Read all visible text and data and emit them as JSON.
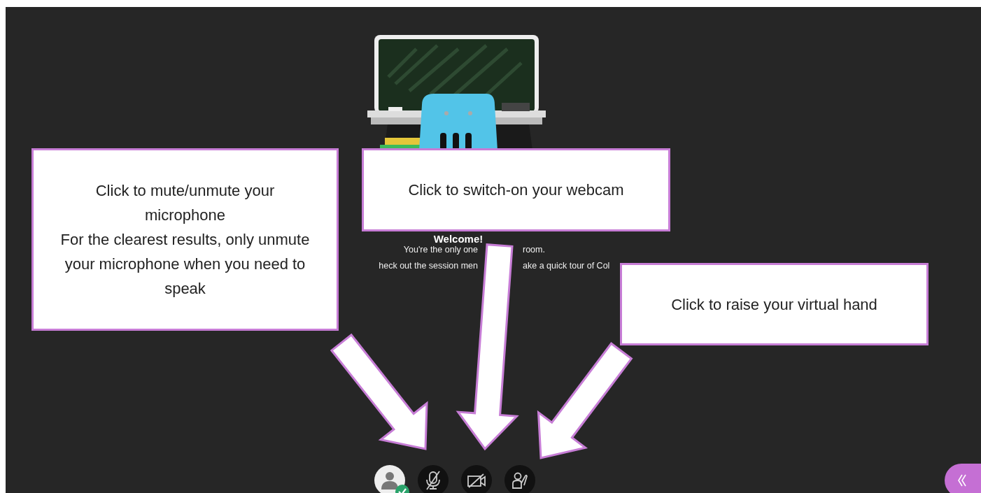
{
  "stage": {
    "welcome": {
      "title": "Welcome!",
      "lines": [
        [
          "You're the only one",
          "room."
        ],
        [
          "heck out the session men",
          "ake a quick tour of Col"
        ]
      ]
    }
  },
  "toolbar": {
    "buttons": [
      {
        "kind": "avatar",
        "online": true
      },
      {
        "kind": "microphone",
        "muted": true
      },
      {
        "kind": "camera",
        "off": true
      },
      {
        "kind": "hand",
        "raised": false
      }
    ]
  },
  "callouts": [
    {
      "text": "Click to mute/unmute your microphone\nFor the clearest results, only unmute your microphone when you need to speak"
    },
    {
      "text": "Click to switch-on your webcam"
    },
    {
      "text": "Click to raise your virtual hand"
    }
  ]
}
